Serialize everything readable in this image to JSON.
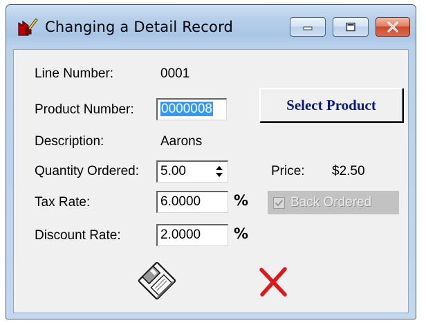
{
  "window": {
    "title": "Changing a Detail Record",
    "minimize_glyph": "minimize-icon",
    "maximize_glyph": "maximize-icon",
    "close_glyph": "close-icon"
  },
  "form": {
    "line_number_label": "Line Number:",
    "line_number_value": "0001",
    "product_number_label": "Product Number:",
    "product_number_value": "0000008",
    "select_product_label": "Select Product",
    "description_label": "Description:",
    "description_value": "Aarons",
    "quantity_label": "Quantity Ordered:",
    "quantity_value": "5.00",
    "price_label": "Price:",
    "price_value": "$2.50",
    "tax_rate_label": "Tax Rate:",
    "tax_rate_value": "6.0000",
    "tax_rate_unit": "%",
    "back_ordered_label": "Back Ordered",
    "back_ordered_checked": true,
    "back_ordered_disabled": true,
    "discount_rate_label": "Discount Rate:",
    "discount_rate_value": "2.0000",
    "discount_rate_unit": "%"
  },
  "actions": {
    "save_icon": "floppy-disk-icon",
    "cancel_icon": "red-x-icon"
  },
  "colors": {
    "select_button_text": "#0a1a78",
    "cancel_x": "#e01818",
    "selection_highlight": "#3399ff"
  }
}
